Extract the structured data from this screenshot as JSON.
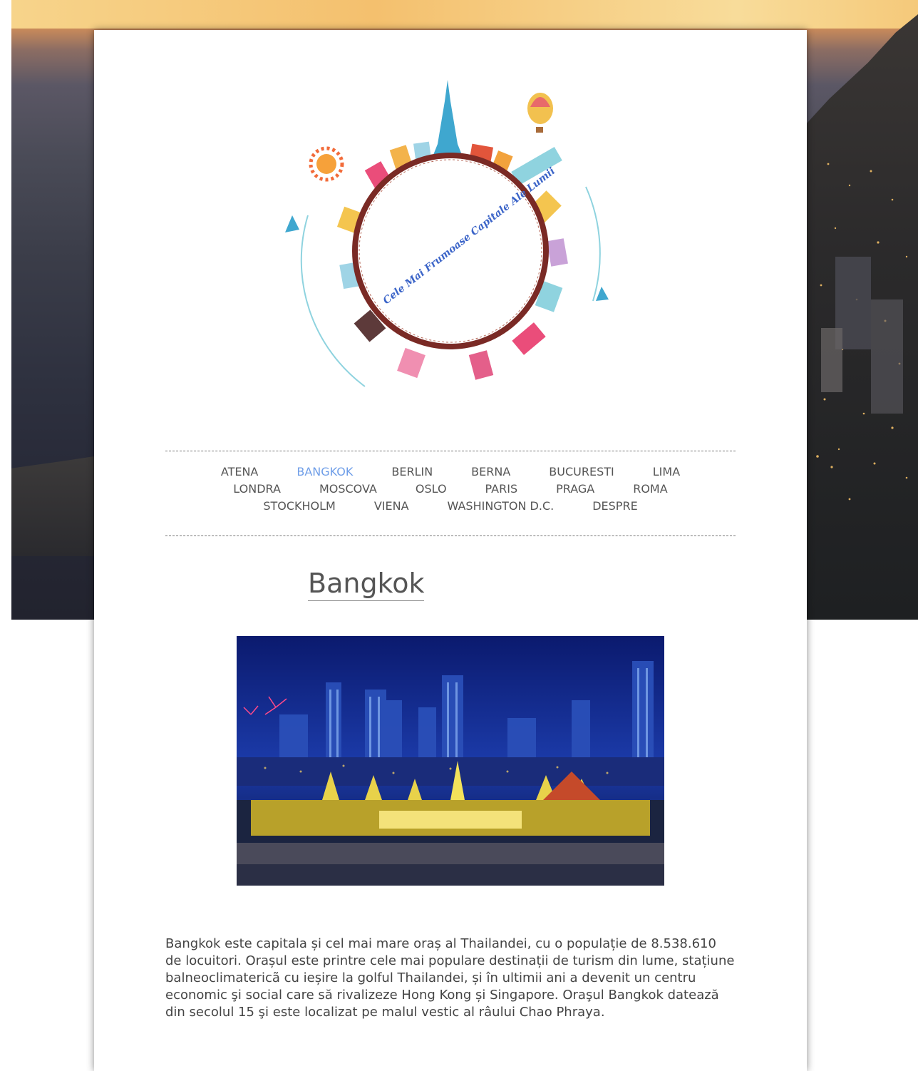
{
  "site": {
    "logo_text": "Cele Mai Frumoase Capitale Ale Lumii"
  },
  "nav": {
    "items": [
      {
        "label": "ATENA"
      },
      {
        "label": "BANGKOK",
        "active": true
      },
      {
        "label": "BERLIN"
      },
      {
        "label": "BERNA"
      },
      {
        "label": "BUCURESTI"
      },
      {
        "label": "LIMA"
      },
      {
        "label": "LONDRA"
      },
      {
        "label": "MOSCOVA"
      },
      {
        "label": "OSLO"
      },
      {
        "label": "PARIS"
      },
      {
        "label": "PRAGA"
      },
      {
        "label": "ROMA"
      },
      {
        "label": "STOCKHOLM"
      },
      {
        "label": "VIENA"
      },
      {
        "label": "WASHINGTON D.C."
      },
      {
        "label": "DESPRE"
      }
    ],
    "active_color": "#6f9ee8"
  },
  "main": {
    "title": "Bangkok",
    "description": "Bangkok este capitala și cel mai mare oraș al Thailandei, cu o populație de 8.538.610 de locuitori. Orașul este printre cele mai populare destinații de turism din lume, stațiune balneoclimatericã cu ieșire la golful Thailandei, și în ultimii ani a devenit un centru economic şi social care să rivalizeze Hong Kong și Singapore. Oraşul Bangkok datează din secolul 15 şi este localizat pe malul vestic al râului Chao Phraya."
  }
}
